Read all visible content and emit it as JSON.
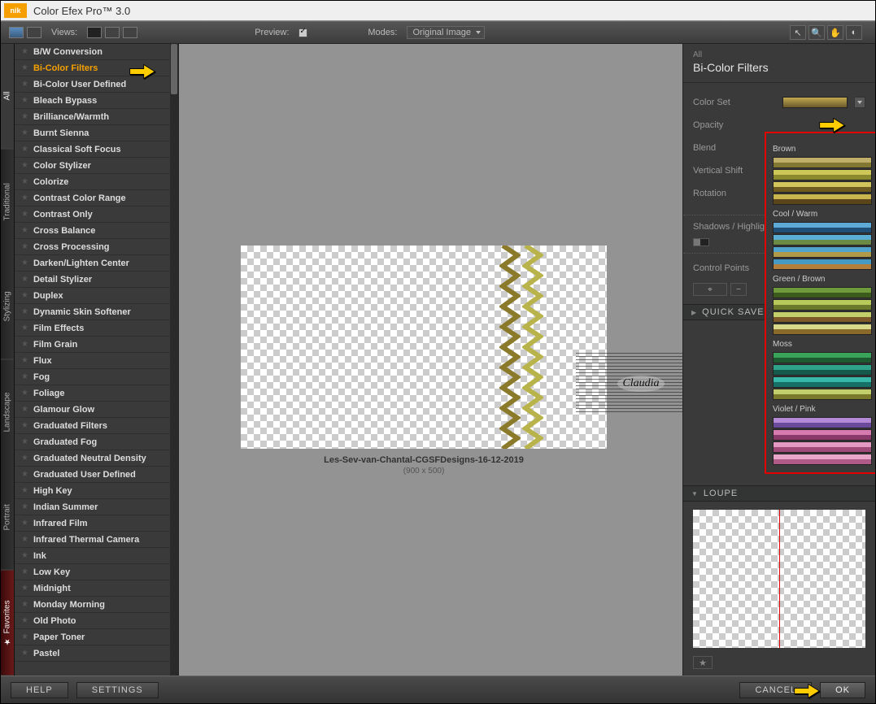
{
  "app": {
    "brand": "nik",
    "title": "Color Efex Pro™ 3.0"
  },
  "toolbar": {
    "views_label": "Views:",
    "preview_label": "Preview:",
    "modes_label": "Modes:",
    "modes_value": "Original Image"
  },
  "category_tabs": [
    "All",
    "Traditional",
    "Stylizing",
    "Landscape",
    "Portrait",
    "Favorites"
  ],
  "filters": [
    "B/W Conversion",
    "Bi-Color Filters",
    "Bi-Color User Defined",
    "Bleach Bypass",
    "Brilliance/Warmth",
    "Burnt Sienna",
    "Classical Soft Focus",
    "Color Stylizer",
    "Colorize",
    "Contrast Color Range",
    "Contrast Only",
    "Cross Balance",
    "Cross Processing",
    "Darken/Lighten Center",
    "Detail Stylizer",
    "Duplex",
    "Dynamic Skin Softener",
    "Film Effects",
    "Film Grain",
    "Flux",
    "Fog",
    "Foliage",
    "Glamour Glow",
    "Graduated Filters",
    "Graduated Fog",
    "Graduated Neutral Density",
    "Graduated User Defined",
    "High Key",
    "Indian Summer",
    "Infrared Film",
    "Infrared Thermal Camera",
    "Ink",
    "Low Key",
    "Midnight",
    "Monday Morning",
    "Old Photo",
    "Paper Toner",
    "Pastel"
  ],
  "selected_filter_index": 1,
  "preview": {
    "caption": "Les-Sev-van-Chantal-CGSFDesigns-16-12-2019",
    "dimensions": "(900 x 500)",
    "watermark": "Claudia"
  },
  "params_panel": {
    "category": "All",
    "filter_name": "Bi-Color Filters",
    "rows": [
      {
        "label": "Color Set"
      },
      {
        "label": "Opacity"
      },
      {
        "label": "Blend"
      },
      {
        "label": "Vertical Shift"
      },
      {
        "label": "Rotation"
      }
    ],
    "shadows_label": "Shadows / Highlights",
    "control_points_label": "Control Points",
    "quick_save_label": "QUICK SAVE",
    "loupe_label": "LOUPE"
  },
  "color_set_dropdown": {
    "groups": [
      {
        "name": "Brown",
        "swatches": [
          "#bfae6a,#817733",
          "#cfc65a,#8b8a2e",
          "#d1c45c,#6f5c21",
          "#c9b54e,#5a4619"
        ]
      },
      {
        "name": "Cool / Warm",
        "swatches": [
          "#5fa9d6,#1f4f77",
          "#5aaed5,#6a8a46",
          "#4fa3cc,#b09a4a",
          "#459ac3,#b47f3a"
        ]
      },
      {
        "name": "Green / Brown",
        "swatches": [
          "#6e9a3c,#3d5a1d",
          "#b7c95a,#6a7a2a",
          "#c2cf6a,#7e5a2a",
          "#d8d98a,#8a6a2a"
        ]
      },
      {
        "name": "Moss",
        "swatches": [
          "#3aa35a,#1e5a2f",
          "#2fa38a,#155a4a",
          "#38b8a8,#167067",
          "#c2cf6a,#7a7a2a"
        ]
      },
      {
        "name": "Violet / Pink",
        "swatches": [
          "#b48ad6,#6a4a9a",
          "#d67ab0,#8a3a6a",
          "#e49ac2,#a04a7a",
          "#e8a6c9,#b05a8a"
        ]
      }
    ]
  },
  "buttons": {
    "help": "HELP",
    "settings": "SETTINGS",
    "cancel": "CANCEL",
    "ok": "OK"
  },
  "chart_data": null
}
